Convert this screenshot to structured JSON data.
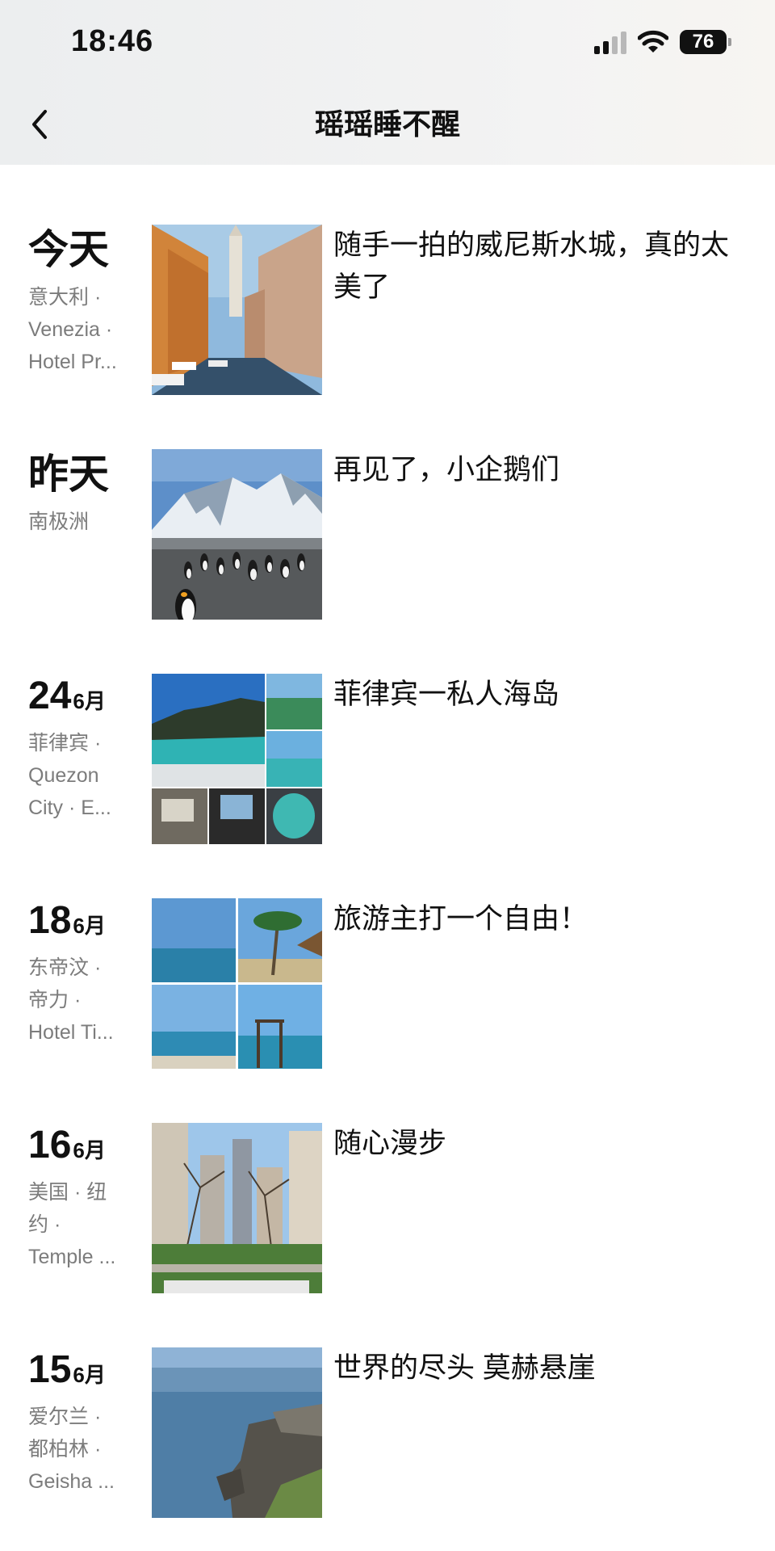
{
  "status_bar": {
    "time": "18:46",
    "battery": "76"
  },
  "header": {
    "title": "瑶瑶睡不醒"
  },
  "entries": [
    {
      "date_text": "今天",
      "day": "",
      "month": "",
      "location": [
        "意大利 ·",
        "Venezia ·",
        "Hotel Pr..."
      ],
      "caption": "随手一拍的威尼斯水城，真的太美了",
      "photo_count": 1
    },
    {
      "date_text": "昨天",
      "day": "",
      "month": "",
      "location": [
        "南极洲"
      ],
      "caption": "再见了，小企鹅们",
      "photo_count": 1
    },
    {
      "date_text": "",
      "day": "24",
      "month": "6月",
      "location": [
        "菲律宾 ·",
        "Quezon",
        "City · E..."
      ],
      "caption": "菲律宾一私人海岛",
      "photo_count": 6
    },
    {
      "date_text": "",
      "day": "18",
      "month": "6月",
      "location": [
        "东帝汶 ·",
        "帝力 ·",
        "Hotel Ti..."
      ],
      "caption": "旅游主打一个自由！",
      "photo_count": 4
    },
    {
      "date_text": "",
      "day": "16",
      "month": "6月",
      "location": [
        "美国 · 纽",
        "约 ·",
        "Temple ..."
      ],
      "caption": "随心漫步",
      "photo_count": 1
    },
    {
      "date_text": "",
      "day": "15",
      "month": "6月",
      "location": [
        "爱尔兰 ·",
        "都柏林 ·",
        "Geisha ..."
      ],
      "caption": "世界的尽头 莫赫悬崖",
      "photo_count": 1
    }
  ]
}
